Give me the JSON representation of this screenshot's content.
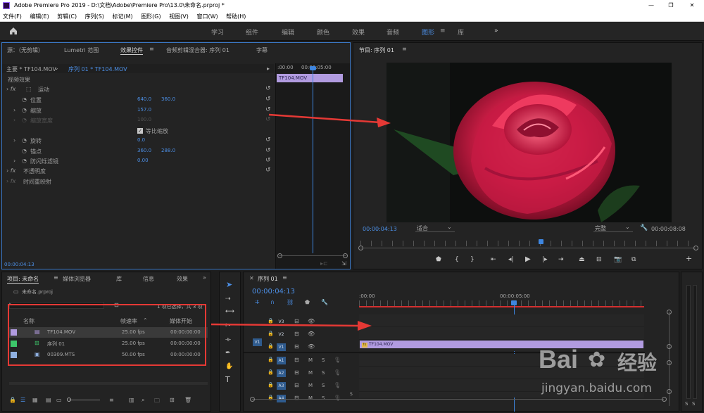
{
  "title": "Adobe Premiere Pro 2019 - D:\\文档\\Adobe\\Premiere Pro\\13.0\\未命名.prproj *",
  "menu": [
    "文件(F)",
    "编辑(E)",
    "剪辑(C)",
    "序列(S)",
    "标记(M)",
    "图形(G)",
    "视图(V)",
    "窗口(W)",
    "帮助(H)"
  ],
  "workspaces": [
    "学习",
    "组件",
    "编辑",
    "颜色",
    "效果",
    "音频",
    "图形",
    "库"
  ],
  "active_workspace": "图形",
  "more_icon": "»",
  "source_panel": {
    "tabs": [
      "源：（无剪辑）",
      "Lumetri 范围",
      "效果控件",
      "音频剪辑混合器: 序列 01",
      "字幕"
    ],
    "header_master": "主要 * TF104.MOV",
    "header_sequence": "序列 01 * TF104.MOV",
    "ruler_start": ":00:00",
    "ruler_mid": "00:00:05:00",
    "clip_label": "TF104.MOV",
    "section_video": "视频效果",
    "motion": "运动",
    "position_label": "位置",
    "position_x": "640.0",
    "position_y": "360.0",
    "scale_label": "缩放",
    "scale_value": "157.0",
    "scale_width_label": "缩放宽度",
    "scale_width_value": "100.0",
    "uniform_scale": "等比缩放",
    "rotation_label": "旋转",
    "rotation_value": "0.0",
    "anchor_label": "锚点",
    "anchor_x": "360.0",
    "anchor_y": "288.0",
    "antiflicker_label": "防闪烁滤镜",
    "antiflicker_value": "0.00",
    "opacity_label": "不透明度",
    "timeremap_label": "时间重映射",
    "timecode": "00:00:04:13"
  },
  "program_panel": {
    "title": "节目: 序列 01",
    "timecode": "00:00:04:13",
    "fit": "适合",
    "quality": "完整",
    "duration": "00:00:08:08"
  },
  "project_panel": {
    "tabs": [
      "项目: 未命名",
      "媒体浏览器",
      "库",
      "信息",
      "效果"
    ],
    "file": "未命名.prproj",
    "selection_info": "1 项已选择，共 3 项",
    "columns": [
      "名称",
      "帧速率",
      "媒体开始"
    ],
    "rows": [
      {
        "color": "#b19be0",
        "name": "TF104.MOV",
        "fps": "25.00 fps",
        "start": "00:00:00:00"
      },
      {
        "color": "#3cc66a",
        "name": "序列 01",
        "fps": "25.00 fps",
        "start": "00:00:00:00"
      },
      {
        "color": "#8fb0e0",
        "name": "00309.MTS",
        "fps": "50.00 fps",
        "start": "00:00:00:00"
      }
    ]
  },
  "timeline_panel": {
    "title": "序列 01",
    "timecode": "00:00:04:13",
    "ruler_start": ":00:00",
    "ruler_mid": "00:00:05:00",
    "video_tracks": [
      "V3",
      "V2",
      "V1"
    ],
    "source_patch_v": "V1",
    "audio_tracks": [
      "A1",
      "A2",
      "A3",
      "A4"
    ],
    "clip_label": "TF104.MOV",
    "mute_label": "M",
    "solo_label": "S",
    "audio_s_label": "S"
  },
  "watermark": {
    "brand": "Bai",
    "brand2": "经验",
    "url": "jingyan.baidu.com"
  },
  "colors": {
    "accent_blue": "#4c8fe6",
    "clip_purple": "#b19be0",
    "annotation_red": "#e53935",
    "playhead": "#3e86e0"
  }
}
